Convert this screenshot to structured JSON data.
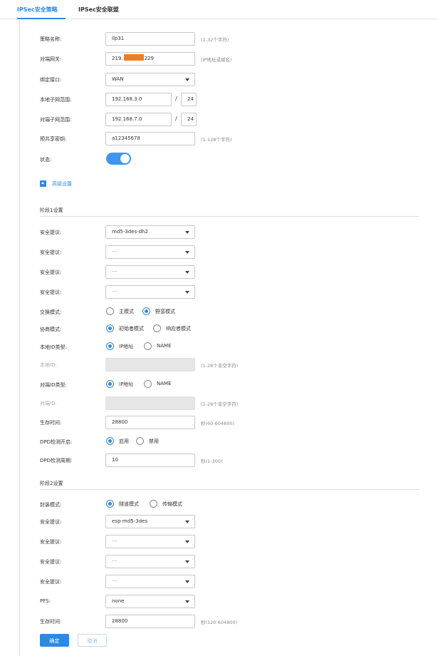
{
  "tabs": [
    {
      "label": "IPSec安全策略"
    },
    {
      "label": "IPSec安全联盟"
    }
  ],
  "form": {
    "policy_name": {
      "label": "策略名称:",
      "value": "llp31",
      "hint": "(1-32个字符)"
    },
    "peer_gateway": {
      "label": "对端网关:",
      "value_prefix": "219.",
      "value_suffix": "229",
      "hint": "(IP地址或域名)"
    },
    "bind_interface": {
      "label": "绑定接口:",
      "value": "WAN"
    },
    "local_subnet": {
      "label": "本地子网范围:",
      "ip": "192.168.3.0",
      "mask": "24"
    },
    "peer_subnet": {
      "label": "对端子网范围:",
      "ip": "192.168.7.0",
      "mask": "24"
    },
    "psk": {
      "label": "预共享密钥:",
      "value": "a12345678",
      "hint": "(1-128个字符)"
    },
    "status": {
      "label": "状态:",
      "enabled": true
    },
    "advanced": {
      "label": "高级设置"
    }
  },
  "phase1": {
    "title": "阶段1设置",
    "proposals": [
      {
        "label": "安全提议:",
        "value": "md5-3des-dh2"
      },
      {
        "label": "安全提议:",
        "value": "---"
      },
      {
        "label": "安全提议:",
        "value": "---"
      },
      {
        "label": "安全提议:",
        "value": "---"
      }
    ],
    "exchange_mode": {
      "label": "交换模式:",
      "options": [
        "主模式",
        "野蛮模式"
      ],
      "selected": 1
    },
    "negotiation_mode": {
      "label": "协商模式:",
      "options": [
        "初始者模式",
        "响应者模式"
      ],
      "selected": 0
    },
    "local_id_type": {
      "label": "本地ID类型:",
      "options": [
        "IP地址",
        "NAME"
      ],
      "selected": 0
    },
    "local_id": {
      "label": "本地ID:",
      "value": "",
      "hint": "(1-28个非空字符)"
    },
    "peer_id_type": {
      "label": "对端ID类型:",
      "options": [
        "IP地址",
        "NAME"
      ],
      "selected": 0
    },
    "peer_id": {
      "label": "对端ID:",
      "value": "",
      "hint": "(1-28个非空字符)"
    },
    "lifetime": {
      "label": "生存时间:",
      "value": "28800",
      "hint": "秒(60-604800)"
    },
    "dpd_enable": {
      "label": "DPD检测开启:",
      "options": [
        "启用",
        "禁用"
      ],
      "selected": 0
    },
    "dpd_interval": {
      "label": "DPD检测周期:",
      "value": "10",
      "hint": "秒(1-300)"
    }
  },
  "phase2": {
    "title": "阶段2设置",
    "encap_mode": {
      "label": "封装模式:",
      "options": [
        "隧道模式",
        "传输模式"
      ],
      "selected": 0
    },
    "proposals": [
      {
        "label": "安全提议:",
        "value": "esp-md5-3des"
      },
      {
        "label": "安全提议:",
        "value": "---"
      },
      {
        "label": "安全提议:",
        "value": "---"
      },
      {
        "label": "安全提议:",
        "value": "---"
      }
    ],
    "pfs": {
      "label": "PFS:",
      "value": "none"
    },
    "lifetime": {
      "label": "生存时间:",
      "value": "28800",
      "hint": "秒(120-604800)"
    }
  },
  "buttons": {
    "ok": "确定",
    "cancel": "取消"
  },
  "colors": {
    "accent": "#2f89e3",
    "redaction": "#ef7d22"
  }
}
